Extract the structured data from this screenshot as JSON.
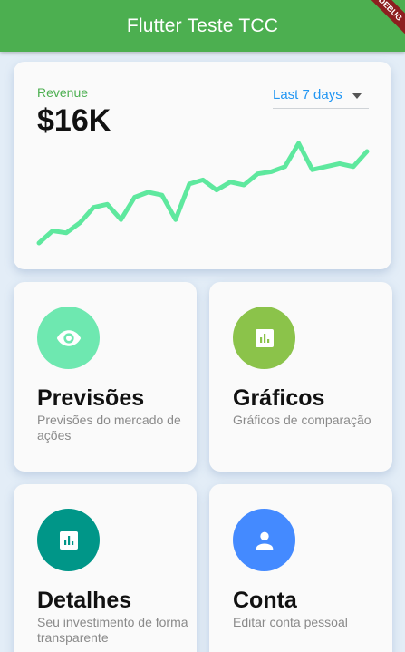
{
  "appbar": {
    "title": "Flutter Teste TCC",
    "debug_label": "DEBUG",
    "color": "#4caf50"
  },
  "revenue": {
    "label": "Revenue",
    "value": "$16K",
    "range_selected": "Last 7 days",
    "sparkline": [
      10,
      22,
      20,
      30,
      45,
      48,
      33,
      55,
      60,
      57,
      33,
      68,
      72,
      62,
      70,
      67,
      78,
      80,
      85,
      108,
      82,
      85,
      88,
      85,
      100
    ],
    "line_color": "#5ee89e"
  },
  "tiles": [
    {
      "title": "Previsões",
      "subtitle": "Previsões do mercado de ações",
      "icon": "eye-icon",
      "color": "#6ee8b0"
    },
    {
      "title": "Gráficos",
      "subtitle": "Gráficos de comparação",
      "icon": "chart-icon",
      "color": "#8bc34a"
    },
    {
      "title": "Detalhes",
      "subtitle": "Seu investimento de forma transparente",
      "icon": "chart-icon",
      "color": "#009688"
    },
    {
      "title": "Conta",
      "subtitle": "Editar conta pessoal",
      "icon": "person-icon",
      "color": "#448aff"
    }
  ]
}
